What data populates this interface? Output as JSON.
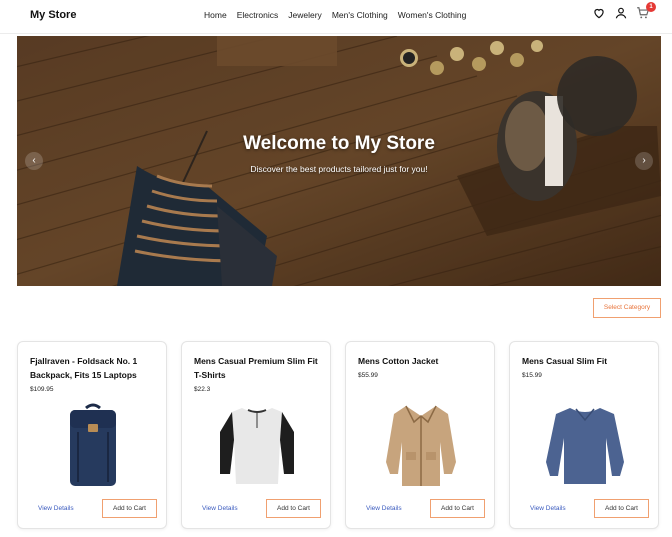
{
  "brand": "My Store",
  "nav": [
    "Home",
    "Electronics",
    "Jewelery",
    "Men's Clothing",
    "Women's Clothing"
  ],
  "cart_count": "1",
  "hero": {
    "title": "Welcome to My Store",
    "subtitle": "Discover the best products tailored just for you!"
  },
  "select_category": "Select Category",
  "products": [
    {
      "title": "Fjallraven - Foldsack No. 1 Backpack, Fits 15 Laptops",
      "price": "$109.95",
      "image": "backpack-image"
    },
    {
      "title": "Mens Casual Premium Slim Fit T-Shirts",
      "price": "$22.3",
      "image": "tshirt-image"
    },
    {
      "title": "Mens Cotton Jacket",
      "price": "$55.99",
      "image": "jacket-image"
    },
    {
      "title": "Mens Casual Slim Fit",
      "price": "$15.99",
      "image": "longsleeve-image"
    }
  ],
  "view_details": "View Details",
  "add_to_cart": "Add to Cart",
  "colors": {
    "accent": "#e8743b",
    "link": "#3b5bbf",
    "badge": "#e53935"
  }
}
